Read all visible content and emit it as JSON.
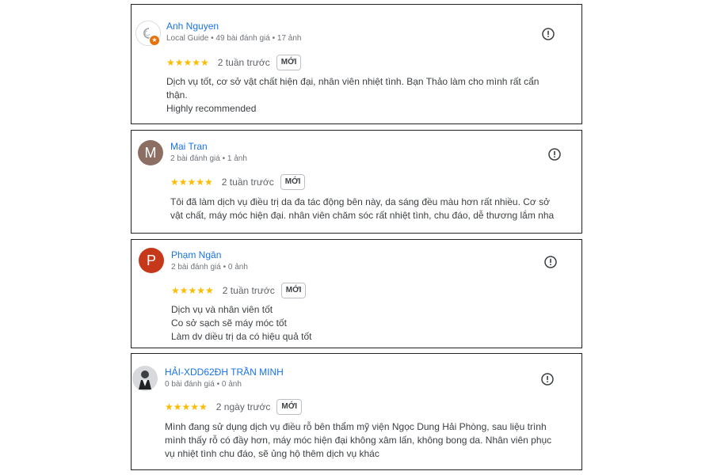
{
  "reviews": [
    {
      "name": "Anh Nguyen",
      "meta": "Local Guide • 49 bài đánh giá • 17 ảnh",
      "stars": "★★★★★",
      "rating": 5,
      "time": "2 tuần trước",
      "badge": "MỚI",
      "lines": [
        "Dịch vụ tốt, cơ sở vật chất hiện đại, nhân viên nhiệt tình. Bạn Thảo làm cho mình rất cẩn",
        "thận.",
        "Highly recommended"
      ]
    },
    {
      "name": "Mai Tran",
      "avatar_letter": "M",
      "avatar_color": "#8d6e63",
      "meta": "2 bài đánh giá • 1 ảnh",
      "stars": "★★★★★",
      "rating": 5,
      "time": "2 tuần trước",
      "badge": "MỚI",
      "lines": [
        "Tôi đã làm dịch vụ điều trị da đa tác động bên này, da sáng đều màu hơn rất nhiều. Cơ sở",
        "vật chất, máy móc hiện đại. nhân viên chăm sóc rất nhiệt tình, chu đáo, dễ thương lắm nha"
      ]
    },
    {
      "name": "Phạm Ngân",
      "avatar_letter": "P",
      "avatar_color": "#c5391a",
      "meta": "2 bài đánh giá • 0 ảnh",
      "stars": "★★★★★",
      "rating": 5,
      "time": "2 tuần trước",
      "badge": "MỚI",
      "lines": [
        "Dịch vụ và nhân viên tốt",
        "Co sở sạch sẽ máy móc tốt",
        "Làm dv diều trị da có hiệu quả tốt"
      ]
    },
    {
      "name": "HẢI-XDD62ĐH TRẦN MINH",
      "meta": "0 bài đánh giá • 0 ảnh",
      "stars": "★★★★★",
      "rating": 5,
      "time": "2 ngày trước",
      "badge": "MỚI",
      "lines": [
        "Mình đang sử dụng dịch vụ điều rỗ bên thẩm mỹ viện Ngọc Dung Hải Phòng, sau liệu trình",
        "mình thấy rỗ có đầy hơn, máy móc hiện đại không xâm lấn, không bong da. Nhân viên phục",
        "vụ nhiệt tình chu đáo, sẽ ủng hộ thêm dịch vụ khác"
      ]
    }
  ],
  "colors": {
    "name": "#1a73e8",
    "star": "#fbbc04",
    "border": "#202124"
  },
  "icons": {
    "report": "report-flag-icon",
    "local_guide": "local-guide-badge-icon"
  }
}
